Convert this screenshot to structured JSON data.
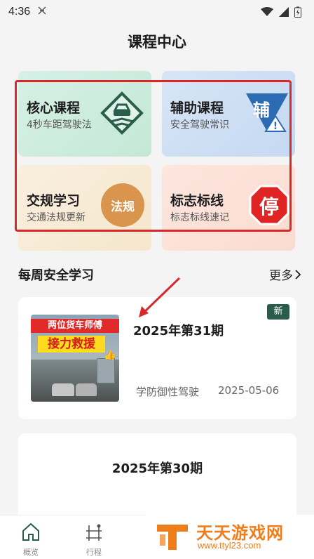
{
  "status_bar": {
    "time": "4:36"
  },
  "header": {
    "title": "课程中心"
  },
  "categories": [
    {
      "title": "核心课程",
      "subtitle": "4秒车距驾驶法",
      "icon": "car-distance-icon"
    },
    {
      "title": "辅助课程",
      "subtitle": "安全驾驶常识",
      "icon_text": "辅",
      "icon": "auxiliary-sign-icon"
    },
    {
      "title": "交规学习",
      "subtitle": "交通法规更新",
      "icon_text": "法规",
      "icon": "regulation-badge-icon"
    },
    {
      "title": "标志标线",
      "subtitle": "标志标线速记",
      "icon_text": "停",
      "icon": "stop-sign-icon"
    }
  ],
  "weekly": {
    "title": "每周安全学习",
    "more_label": "更多",
    "items": [
      {
        "title": "2025年第31期",
        "badge": "新",
        "category": "学防御性驾驶",
        "date": "2025-05-06",
        "thumb_line1": "两位货车师傅",
        "thumb_line2": "接力救援"
      },
      {
        "title": "2025年第30期"
      }
    ]
  },
  "bottom_nav": [
    {
      "label": "概览",
      "icon": "home-icon"
    },
    {
      "label": "行程",
      "icon": "route-icon"
    }
  ],
  "watermark": {
    "title": "天天游戏网",
    "url": "www.ttyl23.com"
  },
  "colors": {
    "accent_green": "#2a5d4b",
    "highlight_red": "#d62a2a",
    "watermark_orange": "#ef7d1a"
  }
}
